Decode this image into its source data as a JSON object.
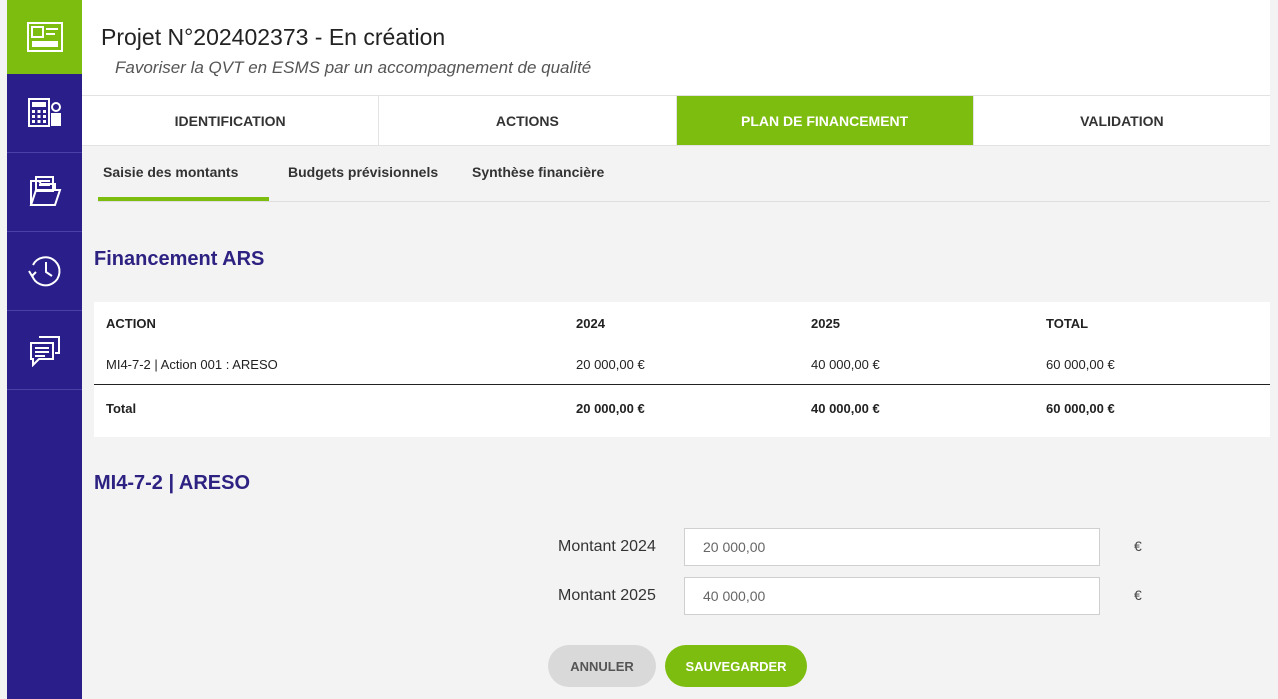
{
  "header": {
    "title": "Projet N°202402373 - En création",
    "subtitle": "Favoriser la QVT en ESMS par un accompagnement de qualité"
  },
  "sidebar": {
    "items": [
      {
        "icon": "id-card-icon",
        "active": true
      },
      {
        "icon": "calculator-user-icon",
        "active": false
      },
      {
        "icon": "folder-document-icon",
        "active": false
      },
      {
        "icon": "history-clock-icon",
        "active": false
      },
      {
        "icon": "chat-bubbles-icon",
        "active": false
      }
    ]
  },
  "tabs": [
    {
      "label": "IDENTIFICATION",
      "active": false
    },
    {
      "label": "ACTIONS",
      "active": false
    },
    {
      "label": "PLAN DE FINANCEMENT",
      "active": true
    },
    {
      "label": "VALIDATION",
      "active": false
    }
  ],
  "subtabs": [
    {
      "label": "Saisie des montants",
      "active": true
    },
    {
      "label": "Budgets prévisionnels",
      "active": false
    },
    {
      "label": "Synthèse financière",
      "active": false
    }
  ],
  "financement": {
    "title": "Financement ARS",
    "columns": [
      "ACTION",
      "2024",
      "2025",
      "TOTAL"
    ],
    "rows": [
      [
        "MI4-7-2 | Action 001 : ARESO",
        "20 000,00 €",
        "40 000,00 €",
        "60 000,00 €"
      ]
    ],
    "total": [
      "Total",
      "20 000,00 €",
      "40 000,00 €",
      "60 000,00 €"
    ]
  },
  "action_form": {
    "title": "MI4-7-2 | ARESO",
    "fields": [
      {
        "label": "Montant 2024",
        "value": "20 000,00",
        "unit": "€"
      },
      {
        "label": "Montant 2025",
        "value": "40 000,00",
        "unit": "€"
      }
    ],
    "cancel_label": "ANNULER",
    "save_label": "SAUVEGARDER"
  },
  "colors": {
    "sidebar": "#2a1f8a",
    "accent_green": "#7dbd0f",
    "title_purple": "#2d2282"
  }
}
